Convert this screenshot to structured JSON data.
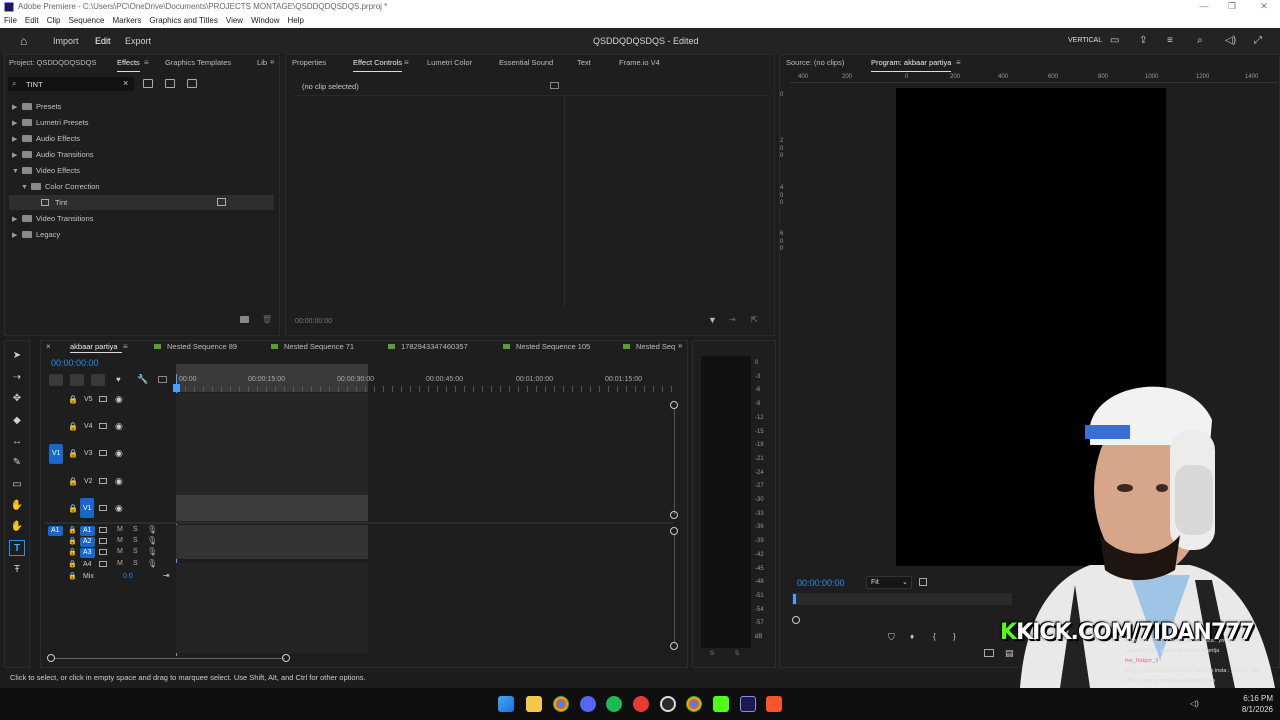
{
  "window": {
    "title": "Adobe Premiere - C:\\Users\\PC\\OneDrive\\Documents\\PROJECTS MONTAGE\\QSDDQDQSDQS.prproj *",
    "controls": [
      "—",
      "❐",
      "✕"
    ]
  },
  "menu": [
    "File",
    "Edit",
    "Clip",
    "Sequence",
    "Markers",
    "Graphics and Titles",
    "View",
    "Window",
    "Help"
  ],
  "header": {
    "nav": [
      "Import",
      "Edit",
      "Export"
    ],
    "active_nav": "Edit",
    "project_title": "QSDDQDQSDQS - Edited",
    "workspace": "VERTICAL"
  },
  "left_panel": {
    "tabs": [
      "Project: QSDDQDQSDQS",
      "Effects",
      "Graphics Templates",
      "Lib"
    ],
    "active_tab": "Effects",
    "search_value": "TINT",
    "tree": [
      "Presets",
      "Lumetri Presets",
      "Audio Effects",
      "Audio Transitions",
      "Video Effects",
      "Color Correction",
      "Tint",
      "Video Transitions",
      "Legacy"
    ]
  },
  "center_panel": {
    "tabs": [
      "Properties",
      "Effect Controls",
      "Lumetri Color",
      "Essential Sound",
      "Text",
      "Frame.io V4"
    ],
    "active_tab": "Effect Controls",
    "no_clip": "(no clip selected)",
    "timecode": "00:00:00:00"
  },
  "monitor": {
    "tabs": [
      "Source: (no clips)",
      "Program: akbaar partiya"
    ],
    "active_tab": "Program: akbaar partiya",
    "ruler": [
      "400",
      "200",
      "0",
      "200",
      "400",
      "600",
      "800",
      "1000",
      "1200",
      "1400"
    ],
    "vruler": [
      "0",
      "2",
      "0",
      "0",
      "4",
      "0",
      "0",
      "6",
      "0",
      "0"
    ],
    "timecode": "00:00:00:00",
    "fit": "Fit"
  },
  "timeline": {
    "tabs": [
      "akbaar partiya",
      "Nested Sequence 89",
      "Nested Sequence 71",
      "1782943347460357",
      "Nested Sequence 105",
      "Nested Seq"
    ],
    "active_tab": "akbaar partiya",
    "timecode": "00:00:00:00",
    "ruler": [
      "00:00",
      "00:00:15:00",
      "00:00:30:00",
      "00:00:45:00",
      "00:01:00:00",
      "00:01:15:00"
    ],
    "video_tracks": [
      "V5",
      "V4",
      "V3",
      "V2",
      "V1"
    ],
    "audio_tracks": [
      "A1",
      "A2",
      "A3",
      "A4"
    ],
    "mix_label": "Mix",
    "mix_value": "0.0",
    "v1_source": "V1",
    "a1_source": "A1",
    "audio_m": "M",
    "audio_s": "S",
    "meter_ticks": [
      "0",
      "-3",
      "-6",
      "-9",
      "-12",
      "-15",
      "-18",
      "-21",
      "-24",
      "-27",
      "-30",
      "-33",
      "-36",
      "-39",
      "-42",
      "-45",
      "-48",
      "-51",
      "-54",
      "-57",
      "dB"
    ],
    "meter_labels": [
      "S",
      "S"
    ]
  },
  "status_bar": "Click to select, or click in empty space and drag to marquee select. Use Shift, Alt, and Ctrl for other options.",
  "overlay": {
    "kick": "KICK.COM/7IDAN777",
    "chat": [
      "/: insta rkan 3la 3chrani lay7idk insta : yovvvv",
      "raiaklen1287: chaine dyali kick bdaritja",
      "fee_Ratger_3 :",
      "Zlcyy : insta rkan 3la 3chrani lay7idk insta : yovvvv_nss",
      "zlalabi: ray yiclaw yinmigi donaychan"
    ]
  },
  "clock": {
    "time": "6:16 PM",
    "date": "8/1/2026"
  },
  "colors": {
    "accent": "#2d8ceb",
    "panel_bg": "#1e1e1e",
    "playhead": "#4a9fff",
    "kick_green": "#53fc18"
  }
}
